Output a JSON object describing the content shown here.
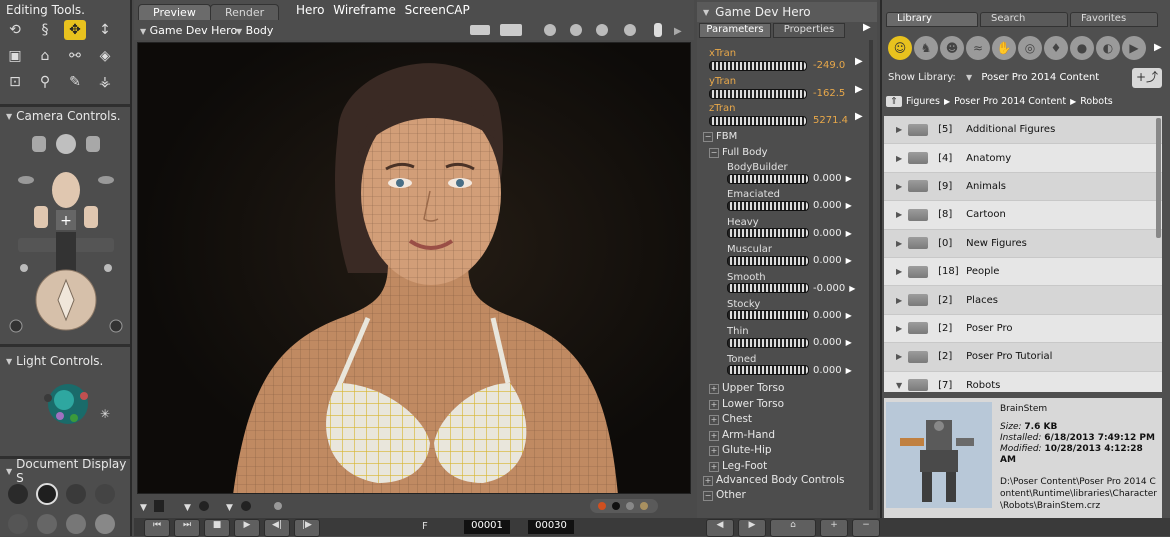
{
  "left": {
    "editing_title": "Editing Tools.",
    "camera_title": "Camera Controls.",
    "light_title": "Light Controls.",
    "document_title": "Document Display S"
  },
  "viewport": {
    "tabs": [
      "Preview",
      "Render"
    ],
    "toolbar_items": [
      "Hero",
      "Wireframe",
      "ScreenCAP"
    ],
    "figure_select": "Game Dev Hero",
    "part_select": "Body"
  },
  "params": {
    "header": "Game Dev Hero",
    "tabs": [
      "Parameters",
      "Properties"
    ],
    "trans": [
      {
        "name": "xTran",
        "value": "-249.0"
      },
      {
        "name": "yTran",
        "value": "-162.5"
      },
      {
        "name": "zTran",
        "value": "5271.4"
      }
    ],
    "fbm_label": "FBM",
    "full_body_label": "Full Body",
    "morphs": [
      {
        "name": "BodyBuilder",
        "value": "0.000"
      },
      {
        "name": "Emaciated",
        "value": "0.000"
      },
      {
        "name": "Heavy",
        "value": "0.000"
      },
      {
        "name": "Muscular",
        "value": "0.000"
      },
      {
        "name": "Smooth",
        "value": "-0.000"
      },
      {
        "name": "Stocky",
        "value": "0.000"
      },
      {
        "name": "Thin",
        "value": "0.000"
      },
      {
        "name": "Toned",
        "value": "0.000"
      }
    ],
    "groups": [
      "Upper Torso",
      "Lower Torso",
      "Chest",
      "Arm-Hand",
      "Glute-Hip",
      "Leg-Foot"
    ],
    "advanced": "Advanced Body Controls",
    "other": "Other"
  },
  "library": {
    "tabs": [
      "Library",
      "Search",
      "Favorites"
    ],
    "show_label": "Show Library:",
    "show_value": "Poser Pro 2014 Content",
    "breadcrumb": [
      "Figures",
      "Poser Pro 2014 Content",
      "Robots"
    ],
    "folders": [
      {
        "count": "[5]",
        "name": "Additional Figures"
      },
      {
        "count": "[4]",
        "name": "Anatomy"
      },
      {
        "count": "[9]",
        "name": "Animals"
      },
      {
        "count": "[8]",
        "name": "Cartoon"
      },
      {
        "count": "[0]",
        "name": "New Figures"
      },
      {
        "count": "[18]",
        "name": "People"
      },
      {
        "count": "[2]",
        "name": "Places"
      },
      {
        "count": "[2]",
        "name": "Poser Pro"
      },
      {
        "count": "[2]",
        "name": "Poser Pro Tutorial"
      },
      {
        "count": "[7]",
        "name": "Robots"
      }
    ],
    "preview": {
      "name": "BrainStem",
      "size_label": "Size:",
      "size": "7.6 KB",
      "installed_label": "Installed:",
      "installed": "6/18/2013 7:49:12 PM",
      "modified_label": "Modified:",
      "modified": "10/28/2013 4:12:28 AM",
      "path": "D:\\Poser Content\\Poser Pro 2014 Content\\Runtime\\libraries\\Character\\Robots\\BrainStem.crz"
    }
  },
  "timeline": {
    "frame_label": "F",
    "frame_value": "00001",
    "frame_total": "00030"
  },
  "colors": {
    "accent": "#e8c21e",
    "param_orange": "#e8a84a"
  }
}
